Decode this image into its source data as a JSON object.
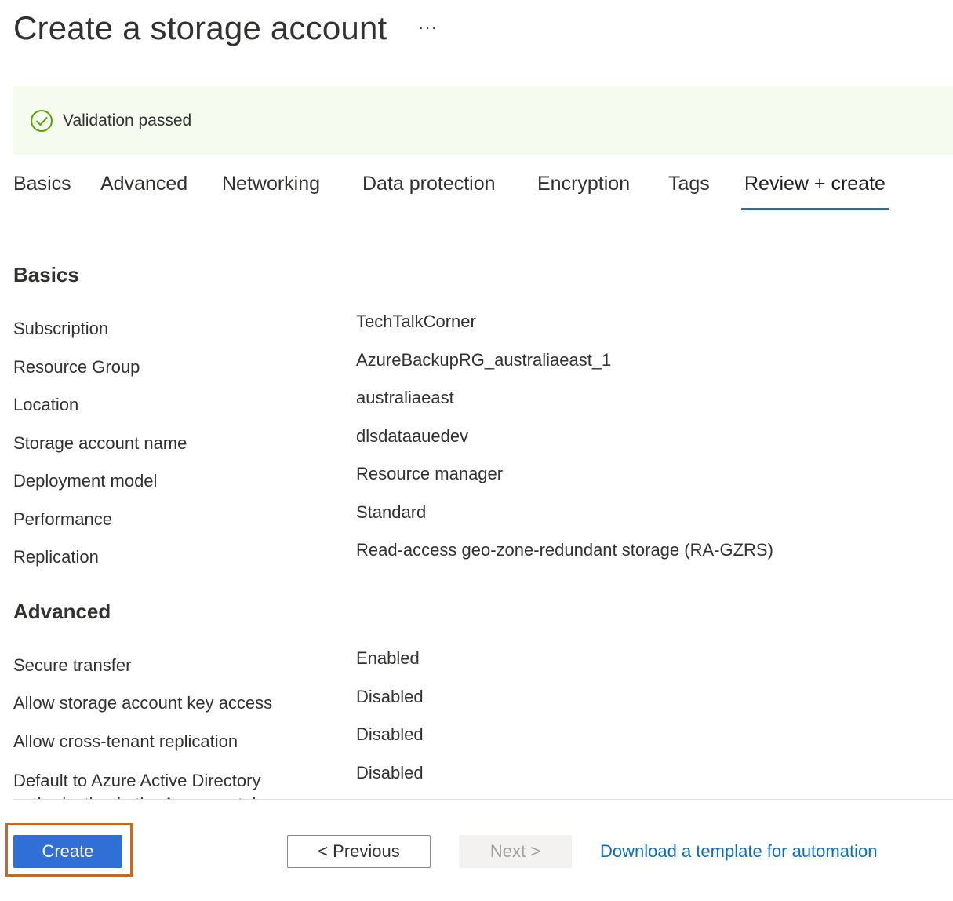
{
  "header": {
    "title": "Create a storage account",
    "more_label": "···"
  },
  "validation": {
    "icon": "check-circle-icon",
    "text": "Validation passed",
    "color": "#57a300"
  },
  "tabs": [
    {
      "label": "Basics"
    },
    {
      "label": "Advanced"
    },
    {
      "label": "Networking"
    },
    {
      "label": "Data protection"
    },
    {
      "label": "Encryption"
    },
    {
      "label": "Tags"
    },
    {
      "label": "Review + create",
      "active": true
    }
  ],
  "sections": [
    {
      "title": "Basics",
      "rows": [
        {
          "label": "Subscription",
          "value": "TechTalkCorner"
        },
        {
          "label": "Resource Group",
          "value": "AzureBackupRG_australiaeast_1"
        },
        {
          "label": "Location",
          "value": "australiaeast"
        },
        {
          "label": "Storage account name",
          "value": "dlsdataauedev"
        },
        {
          "label": "Deployment model",
          "value": "Resource manager"
        },
        {
          "label": "Performance",
          "value": "Standard"
        },
        {
          "label": "Replication",
          "value": "Read-access geo-zone-redundant storage (RA-GZRS)"
        }
      ]
    },
    {
      "title": "Advanced",
      "rows": [
        {
          "label": "Secure transfer",
          "value": "Enabled"
        },
        {
          "label": "Allow storage account key access",
          "value": "Disabled"
        },
        {
          "label": "Allow cross-tenant replication",
          "value": "Disabled"
        },
        {
          "label": "Default to Azure Active Directory authorization in the Azure portal",
          "value": "Disabled"
        }
      ]
    }
  ],
  "footer": {
    "create_label": "Create",
    "previous_label": "< Previous",
    "next_label": "Next >",
    "download_link": "Download a template for automation"
  },
  "colors": {
    "primary": "#2f6fd6",
    "tab_underline": "#0078d4",
    "validation_bg": "#f5fbef",
    "highlight_border": "#c06a22",
    "link": "#0f6cbd"
  }
}
